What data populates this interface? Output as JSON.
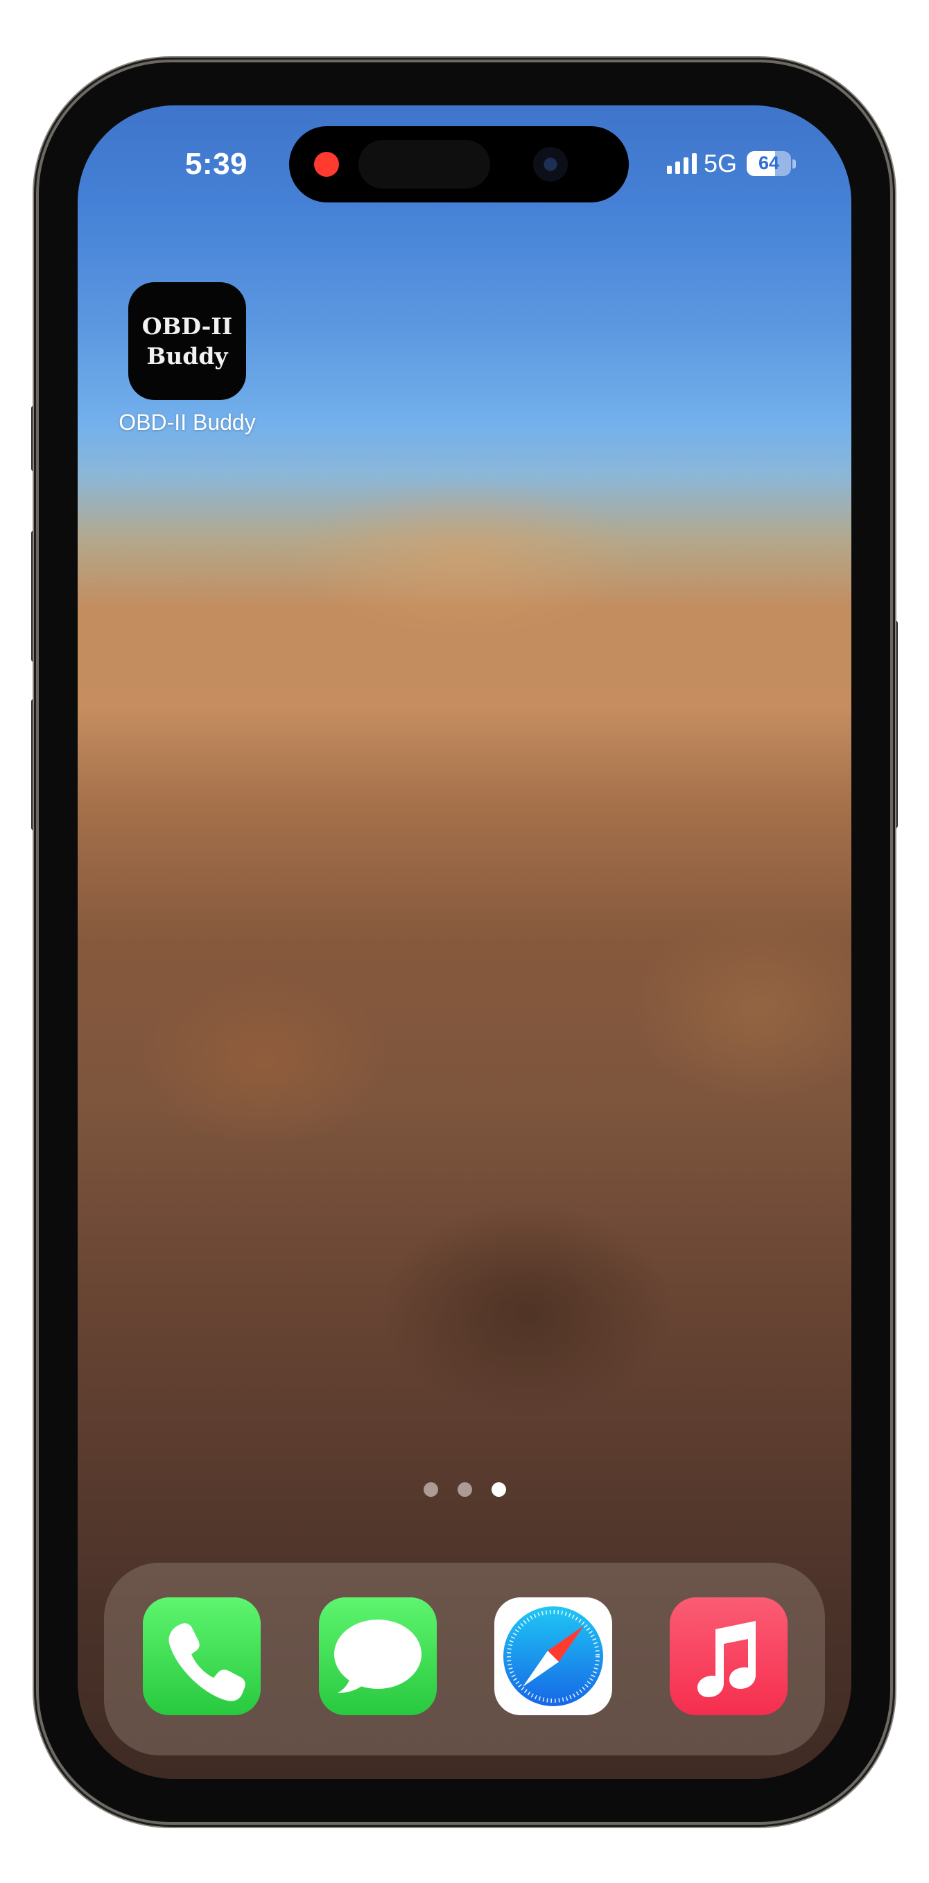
{
  "status_bar": {
    "time": "5:39",
    "network": "5G",
    "battery_percent": "64",
    "battery_level": 0.64,
    "recording_indicator_color": "#ff3b30"
  },
  "home_screen": {
    "apps": [
      {
        "label": "OBD-II Buddy",
        "icon_text_line1": "OBD-II",
        "icon_text_line2": "Buddy",
        "icon_background": "#050505"
      }
    ],
    "page_indicator": {
      "pages": 3,
      "current_page": 3
    }
  },
  "dock": {
    "apps": [
      {
        "icon": "phone-icon",
        "color": "#34c759"
      },
      {
        "icon": "messages-icon",
        "color": "#34c759"
      },
      {
        "icon": "safari-icon",
        "color": "#1a73e8"
      },
      {
        "icon": "music-icon",
        "color": "#fa2d48"
      }
    ]
  }
}
